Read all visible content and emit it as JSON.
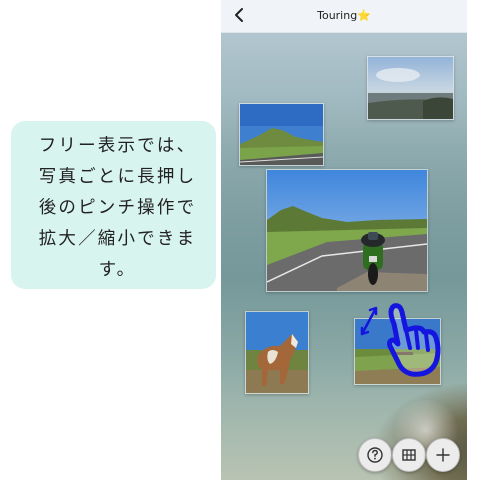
{
  "callout": {
    "text": "フリー表示では、\n写真ごとに長押し\n後のピンチ操作で\n拡大／縮小できま\nす。"
  },
  "app": {
    "title": "Touring⭐",
    "back_icon": "chevron-left-icon",
    "photos": [
      {
        "name": "photo-coast-town",
        "subject": "seaside-town"
      },
      {
        "name": "photo-green-hill",
        "subject": "green-mountain-road"
      },
      {
        "name": "photo-motorcycle",
        "subject": "motorcycle-on-road"
      },
      {
        "name": "photo-horse",
        "subject": "horse"
      },
      {
        "name": "photo-meadow",
        "subject": "grassland"
      }
    ],
    "gesture_hint_icons": [
      "resize-arrows-icon",
      "hand-pinch-icon"
    ],
    "buttons": [
      {
        "name": "help-button",
        "icon": "question-icon"
      },
      {
        "name": "layout-button",
        "icon": "grid-icon"
      },
      {
        "name": "add-button",
        "icon": "plus-icon"
      }
    ]
  },
  "colors": {
    "callout_bg": "#d8f4ee",
    "hint_blue": "#1515e0",
    "navbar_bg": "#f0f3f7"
  }
}
